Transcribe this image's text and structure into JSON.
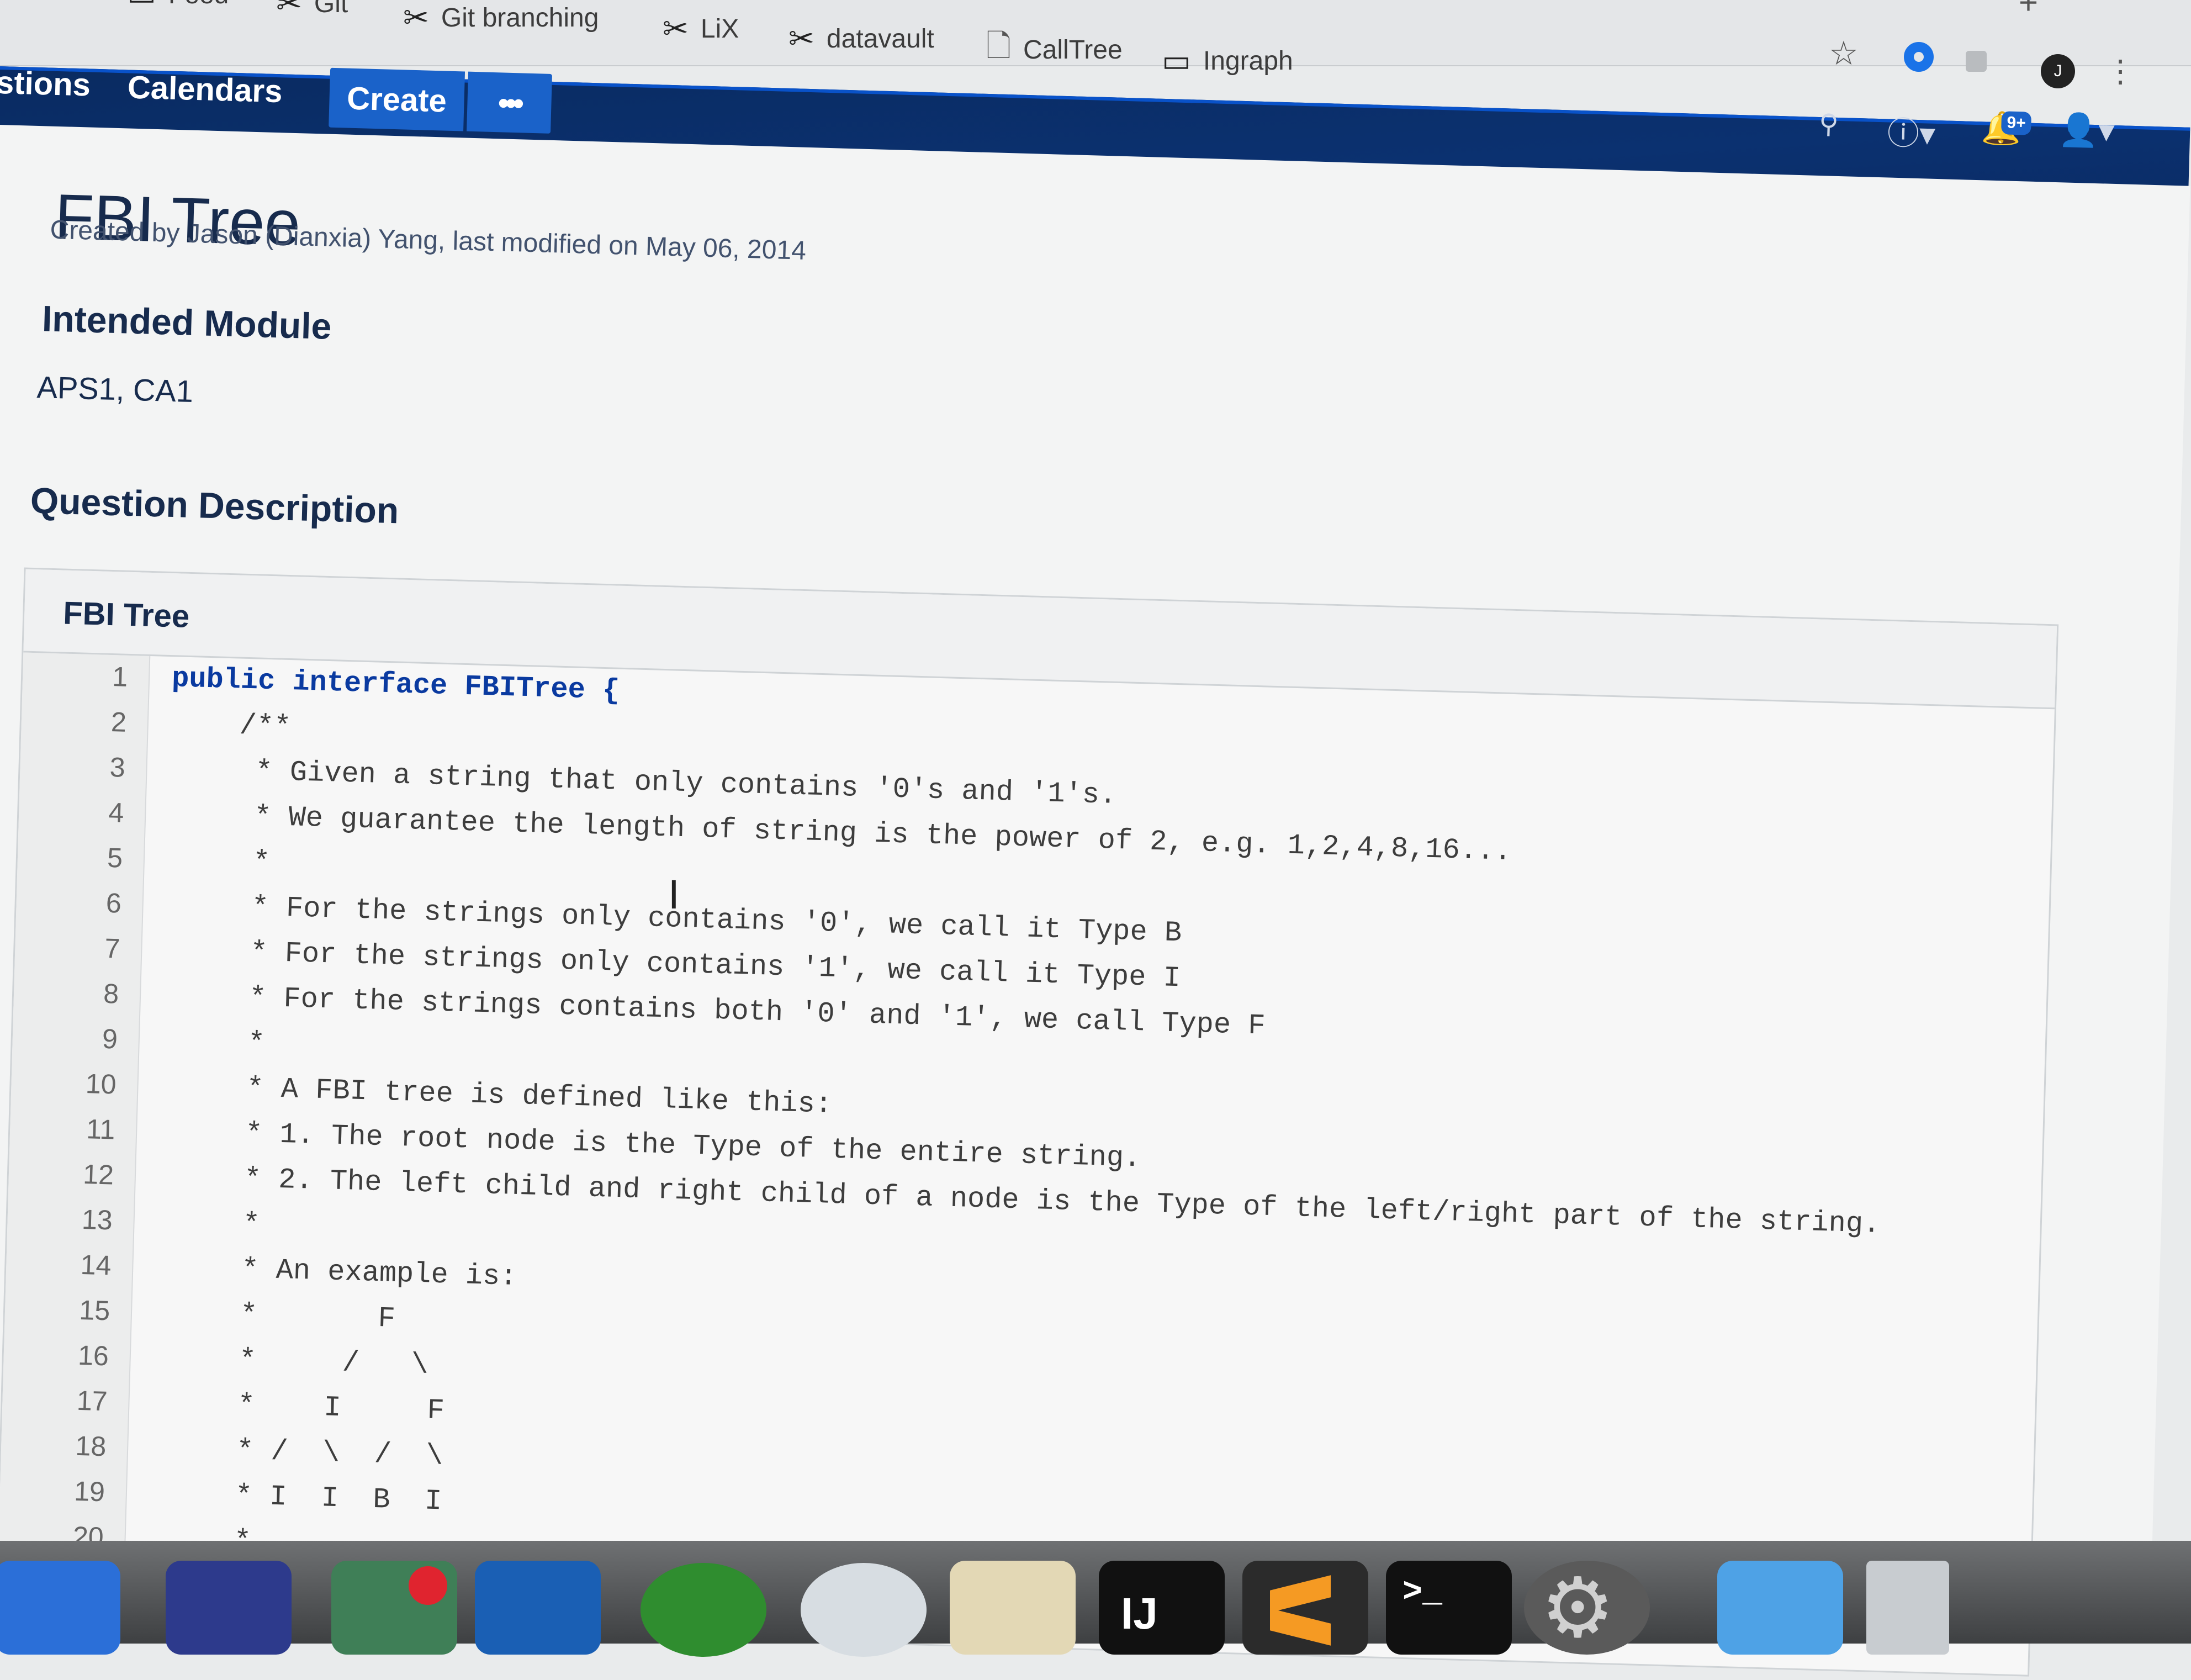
{
  "bookmarks": [
    {
      "label": "Feed",
      "icon": "folder-icon"
    },
    {
      "label": "Git",
      "icon": "tool-icon"
    },
    {
      "label": "Git branching",
      "icon": "tool-icon"
    },
    {
      "label": "LiX",
      "icon": "tool-icon"
    },
    {
      "label": "datavault",
      "icon": "tool-icon"
    },
    {
      "label": "CallTree",
      "icon": "document-icon"
    },
    {
      "label": "Ingraph",
      "icon": "folder-icon"
    }
  ],
  "nav": {
    "questions_label": "stions",
    "calendars_label": "Calendars",
    "create_label": "Create",
    "more_label": "•••",
    "notifications_badge": "9+"
  },
  "page": {
    "title": "FBI Tree",
    "byline": "Created by Jason (Dianxia) Yang, last modified on May 06, 2014",
    "module_heading": "Intended Module",
    "module_value": "APS1, CA1",
    "question_heading": "Question Description"
  },
  "code_block": {
    "title": "FBI Tree",
    "lines": [
      {
        "n": "1",
        "text": "public interface FBITree {"
      },
      {
        "n": "2",
        "text": "    /**"
      },
      {
        "n": "3",
        "text": "     * Given a string that only contains '0's and '1's."
      },
      {
        "n": "4",
        "text": "     * We guarantee the length of string is the power of 2, e.g. 1,2,4,8,16..."
      },
      {
        "n": "5",
        "text": "     *"
      },
      {
        "n": "6",
        "text": "     * For the strings only contains '0', we call it Type B"
      },
      {
        "n": "7",
        "text": "     * For the strings only contains '1', we call it Type I"
      },
      {
        "n": "8",
        "text": "     * For the strings contains both '0' and '1', we call Type F"
      },
      {
        "n": "9",
        "text": "     *"
      },
      {
        "n": "10",
        "text": "     * A FBI tree is defined like this:"
      },
      {
        "n": "11",
        "text": "     * 1. The root node is the Type of the entire string."
      },
      {
        "n": "12",
        "text": "     * 2. The left child and right child of a node is the Type of the left/right part of the string."
      },
      {
        "n": "13",
        "text": "     *"
      },
      {
        "n": "14",
        "text": "     * An example is:"
      },
      {
        "n": "15",
        "text": "     *       F"
      },
      {
        "n": "16",
        "text": "     *     /   \\"
      },
      {
        "n": "17",
        "text": "     *    I     F"
      },
      {
        "n": "18",
        "text": "     * /  \\  /  \\"
      },
      {
        "n": "19",
        "text": "     * I  I  B  I"
      },
      {
        "n": "20",
        "text": "     * .  .  .  ."
      }
    ]
  },
  "dock": {
    "apps": [
      {
        "name": "finder",
        "icon": "finder-icon",
        "color": "#2b6fd8"
      },
      {
        "name": "launchpad",
        "icon": "launchpad-icon",
        "color": "#2d3a8c"
      },
      {
        "name": "mail-app",
        "icon": "mail-icon",
        "color": "#3f7f57"
      },
      {
        "name": "outlook",
        "icon": "outlook-icon",
        "color": "#1a5fb4"
      },
      {
        "name": "xbox",
        "icon": "xbox-icon",
        "color": "#2f8d2f"
      },
      {
        "name": "wifi-app",
        "icon": "wifi-icon",
        "color": "#d7dde2"
      },
      {
        "name": "slack",
        "icon": "slack-icon",
        "color": "#e3d8b5"
      },
      {
        "name": "intellij",
        "icon": "intellij-icon",
        "color": "#111111",
        "label": "IJ"
      },
      {
        "name": "sublime",
        "icon": "sublime-icon",
        "color": "#2b2b2b"
      },
      {
        "name": "terminal",
        "icon": "terminal-icon",
        "color": "#111111",
        "label": ">_"
      },
      {
        "name": "system-preferences",
        "icon": "gear-icon",
        "color": "#5a5a5a"
      },
      {
        "name": "downloads",
        "icon": "downloads-icon",
        "color": "#4ea2e6"
      },
      {
        "name": "trash",
        "icon": "trash-icon",
        "color": "#c8ccd0"
      }
    ]
  }
}
